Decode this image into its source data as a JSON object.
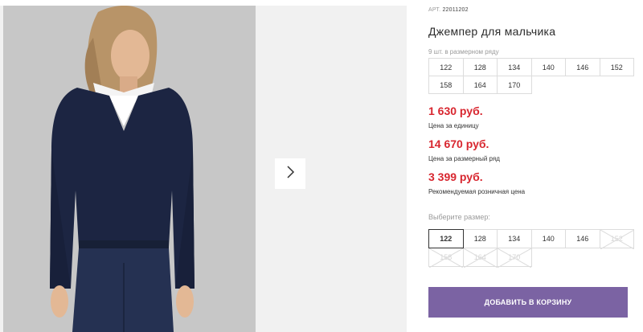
{
  "product": {
    "article_label": "АРТ.",
    "article_number": "22011202",
    "title": "Джемпер для мальчика",
    "image": "boy-in-navy-v-neck-sweater"
  },
  "gallery": {
    "next_icon": "chevron-right-icon"
  },
  "pack": {
    "caption": "9 шт. в размерном ряду",
    "sizes": [
      "122",
      "128",
      "134",
      "140",
      "146",
      "152",
      "158",
      "164",
      "170"
    ]
  },
  "prices": [
    {
      "value": "1 630 руб.",
      "label": "Цена за единицу"
    },
    {
      "value": "14 670 руб.",
      "label": "Цена за размерный ряд"
    },
    {
      "value": "3 399 руб.",
      "label": "Рекомендуемая розничная цена"
    }
  ],
  "size_picker": {
    "label": "Выберите размер:",
    "selected": "122",
    "sizes": [
      {
        "size": "122",
        "available": true
      },
      {
        "size": "128",
        "available": true
      },
      {
        "size": "134",
        "available": true
      },
      {
        "size": "140",
        "available": true
      },
      {
        "size": "146",
        "available": true
      },
      {
        "size": "152",
        "available": false
      },
      {
        "size": "158",
        "available": false
      },
      {
        "size": "164",
        "available": false
      },
      {
        "size": "170",
        "available": false
      }
    ]
  },
  "cart": {
    "add_label": "ДОБАВИТЬ В КОРЗИНУ"
  },
  "colors": {
    "price": "#d8262f",
    "button": "#7b63a3",
    "sweater": "#1c2542"
  }
}
